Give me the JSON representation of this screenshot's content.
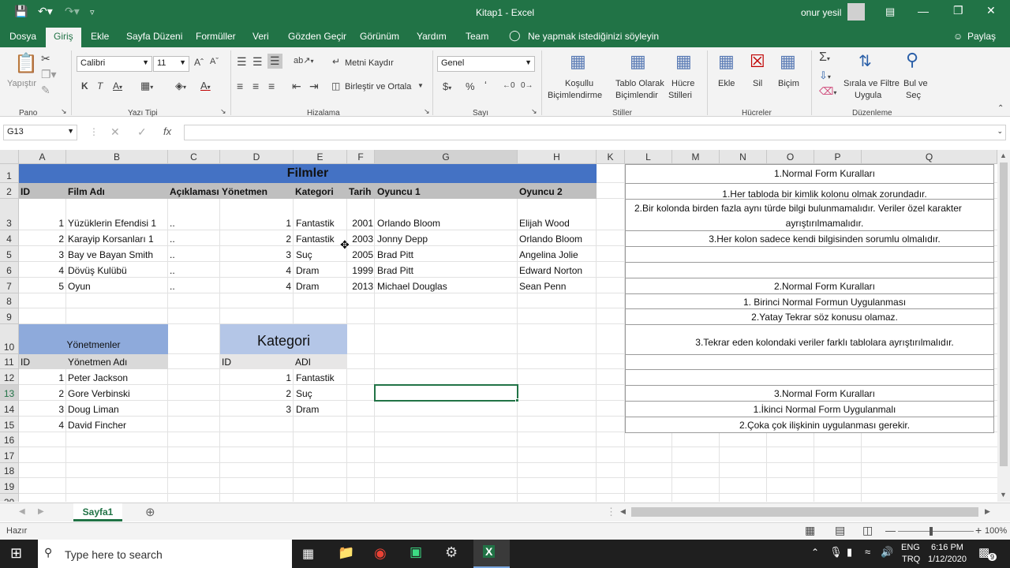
{
  "window": {
    "title": "Kitap1  -  Excel",
    "user": "onur yesil"
  },
  "menu": {
    "tabs": [
      "Dosya",
      "Giriş",
      "Ekle",
      "Sayfa Düzeni",
      "Formüller",
      "Veri",
      "Gözden Geçir",
      "Görünüm",
      "Yardım",
      "Team"
    ],
    "tell_me": "Ne yapmak istediğinizi söyleyin",
    "share": "Paylaş"
  },
  "ribbon": {
    "paste": "Yapıştır",
    "font_name": "Calibri",
    "font_size": "11",
    "wrap": "Metni Kaydır",
    "merge": "Birleştir ve Ortala",
    "number_format": "Genel",
    "cond1": "Koşullu",
    "cond2": "Biçimlendirme",
    "table1": "Tablo Olarak",
    "table2": "Biçimlendir",
    "cell1": "Hücre",
    "cell2": "Stilleri",
    "insert": "Ekle",
    "delete": "Sil",
    "format": "Biçim",
    "sort1": "Sırala ve Filtre",
    "sort2": "Uygula",
    "find1": "Bul ve",
    "find2": "Seç",
    "groups": {
      "pano": "Pano",
      "font": "Yazı Tipi",
      "align": "Hizalama",
      "number": "Sayı",
      "styles": "Stiller",
      "cells": "Hücreler",
      "edit": "Düzenleme"
    }
  },
  "formula_bar": {
    "name_box": "G13",
    "content": ""
  },
  "columns": [
    "A",
    "B",
    "C",
    "D",
    "E",
    "F",
    "G",
    "H",
    "K",
    "L",
    "M",
    "N",
    "O",
    "P",
    "Q"
  ],
  "rows": [
    "1",
    "2",
    "3",
    "4",
    "5",
    "6",
    "7",
    "8",
    "9",
    "10",
    "11",
    "12",
    "13",
    "14",
    "15",
    "16",
    "17",
    "18",
    "19",
    "20"
  ],
  "films": {
    "title": "Filmler",
    "headers": [
      "ID",
      "Film Adı",
      "Açıklaması",
      "Yönetmen",
      "Kategori",
      "Tarih",
      "Oyuncu 1",
      "Oyuncu 2"
    ],
    "rows": [
      [
        "1",
        "Yüzüklerin Efendisi 1",
        "..",
        "1",
        "Fantastik",
        "2001",
        "Orlando Bloom",
        "Elijah Wood"
      ],
      [
        "2",
        "Karayip Korsanları 1",
        "..",
        "2",
        "Fantastik",
        "2003",
        "Jonny Depp",
        "Orlando Bloom"
      ],
      [
        "3",
        "Bay ve Bayan Smith",
        "..",
        "3",
        "Suç",
        "2005",
        "Brad Pitt",
        "Angelina Jolie"
      ],
      [
        "4",
        "Dövüş Kulübü",
        "..",
        "4",
        "Dram",
        "1999",
        "Brad Pitt",
        "Edward Norton"
      ],
      [
        "5",
        "Oyun",
        "..",
        "4",
        "Dram",
        "2013",
        "Michael Douglas",
        "Sean Penn"
      ]
    ]
  },
  "directors": {
    "title": "Yönetmenler",
    "headers": [
      "ID",
      "Yönetmen Adı"
    ],
    "rows": [
      [
        "1",
        "Peter Jackson"
      ],
      [
        "2",
        "Gore Verbinski"
      ],
      [
        "3",
        "Doug Liman"
      ],
      [
        "4",
        "David Fincher"
      ]
    ]
  },
  "category": {
    "title": "Kategori",
    "headers": [
      "ID",
      "ADI"
    ],
    "rows": [
      [
        "1",
        "Fantastik"
      ],
      [
        "2",
        "Suç"
      ],
      [
        "3",
        "Dram"
      ]
    ]
  },
  "rules": {
    "r1": "1.Normal Form Kuralları",
    "r2": "1.Her tabloda bir kimlik kolonu olmak zorundadır.",
    "r3a": "2.Bir kolonda birden fazla aynı türde bilgi bulunmamalıdır. Veriler özel karakter",
    "r3b": "ayrıştırılmamalıdır.",
    "r4": "3.Her kolon sadece kendi bilgisinden sorumlu olmalıdır.",
    "r7": "2.Normal Form Kuralları",
    "r8": "1. Birinci Normal Formun Uygulanması",
    "r9": "2.Yatay Tekrar söz konusu olamaz.",
    "r10": "3.Tekrar eden kolondaki veriler farklı tablolara ayrıştırılmalıdır.",
    "r13": "3.Normal Form Kuralları",
    "r14": "1.İkinci Normal Form Uygulanmalı",
    "r15": "2.Çoka çok ilişkinin uygulanması gerekir."
  },
  "sheet": {
    "tab": "Sayfa1"
  },
  "status": {
    "ready": "Hazır",
    "zoom": "100%"
  },
  "taskbar": {
    "search": "Type here to search",
    "lang1": "ENG",
    "lang2": "TRQ",
    "time": "6:16 PM",
    "date": "1/12/2020",
    "notif": "9"
  },
  "colors": {
    "excel_green": "#217346",
    "film_title_fill": "#4472c4",
    "header_gray": "#bfbfbf",
    "director_fill": "#8eaadb",
    "category_fill": "#b4c6e7",
    "subheader_gray": "#d9d9d9"
  }
}
